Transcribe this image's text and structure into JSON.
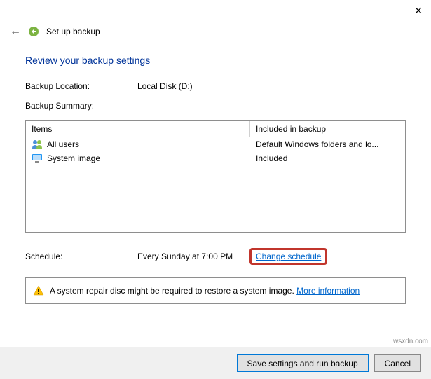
{
  "window": {
    "title": "Set up backup"
  },
  "page": {
    "title": "Review your backup settings",
    "backup_location_label": "Backup Location:",
    "backup_location_value": "Local Disk (D:)",
    "backup_summary_label": "Backup Summary:"
  },
  "summary": {
    "headers": {
      "items": "Items",
      "included": "Included in backup"
    },
    "rows": [
      {
        "name": "All users",
        "included": "Default Windows folders and lo..."
      },
      {
        "name": "System image",
        "included": "Included"
      }
    ]
  },
  "schedule": {
    "label": "Schedule:",
    "value": "Every Sunday at 7:00 PM",
    "change_link": "Change schedule"
  },
  "warning": {
    "text": "A system repair disc might be required to restore a system image.",
    "more_info": "More information"
  },
  "footer": {
    "save_label": "Save settings and run backup",
    "cancel_label": "Cancel"
  },
  "watermark": "wsxdn.com"
}
